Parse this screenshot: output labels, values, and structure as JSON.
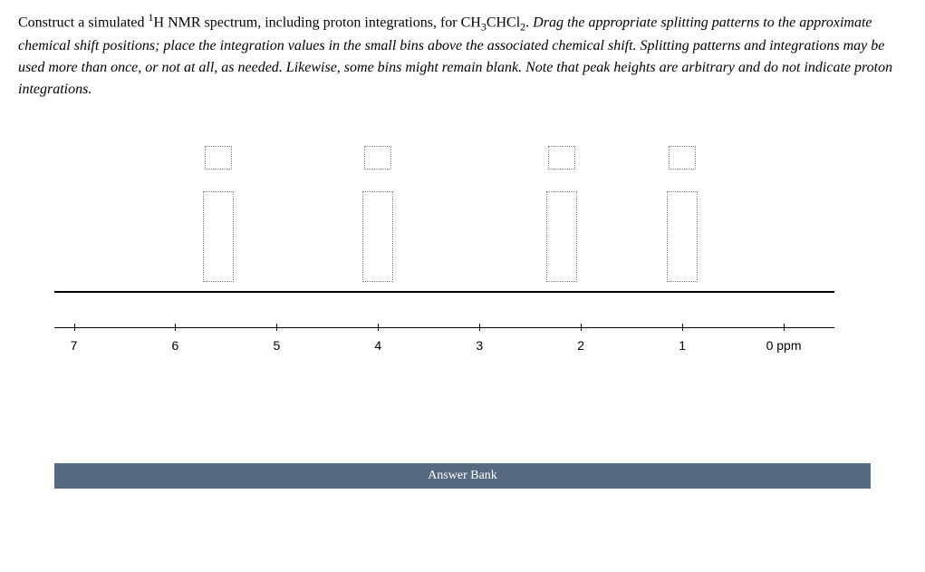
{
  "instructions": {
    "part1_prefix": "Construct a simulated ",
    "superscript": "1",
    "part1_mid": "H NMR spectrum, including proton integrations, for CH",
    "sub1": "3",
    "part1_mid2": "CHCl",
    "sub2": "2",
    "part1_suffix": ". ",
    "italic_text": "Drag the appropriate splitting patterns to the approximate chemical shift positions; place the integration values in the small bins above the associated chemical shift. Splitting patterns and integrations may be used more than once, or not at all, as needed. Likewise, some bins might remain blank. Note that peak heights are arbitrary and do not indicate proton integrations."
  },
  "axis": {
    "ticks": [
      {
        "label": "7",
        "pos_pct": 2.5
      },
      {
        "label": "6",
        "pos_pct": 15.5
      },
      {
        "label": "5",
        "pos_pct": 28.5
      },
      {
        "label": "4",
        "pos_pct": 41.5
      },
      {
        "label": "3",
        "pos_pct": 54.5
      },
      {
        "label": "2",
        "pos_pct": 67.5
      },
      {
        "label": "1",
        "pos_pct": 80.5
      },
      {
        "label": "0 ppm",
        "pos_pct": 93.5
      }
    ]
  },
  "bins": {
    "positions": [
      {
        "pos_pct": 21.0
      },
      {
        "pos_pct": 41.5
      },
      {
        "pos_pct": 65.0
      },
      {
        "pos_pct": 80.5
      }
    ]
  },
  "answer_bank_label": "Answer Bank"
}
